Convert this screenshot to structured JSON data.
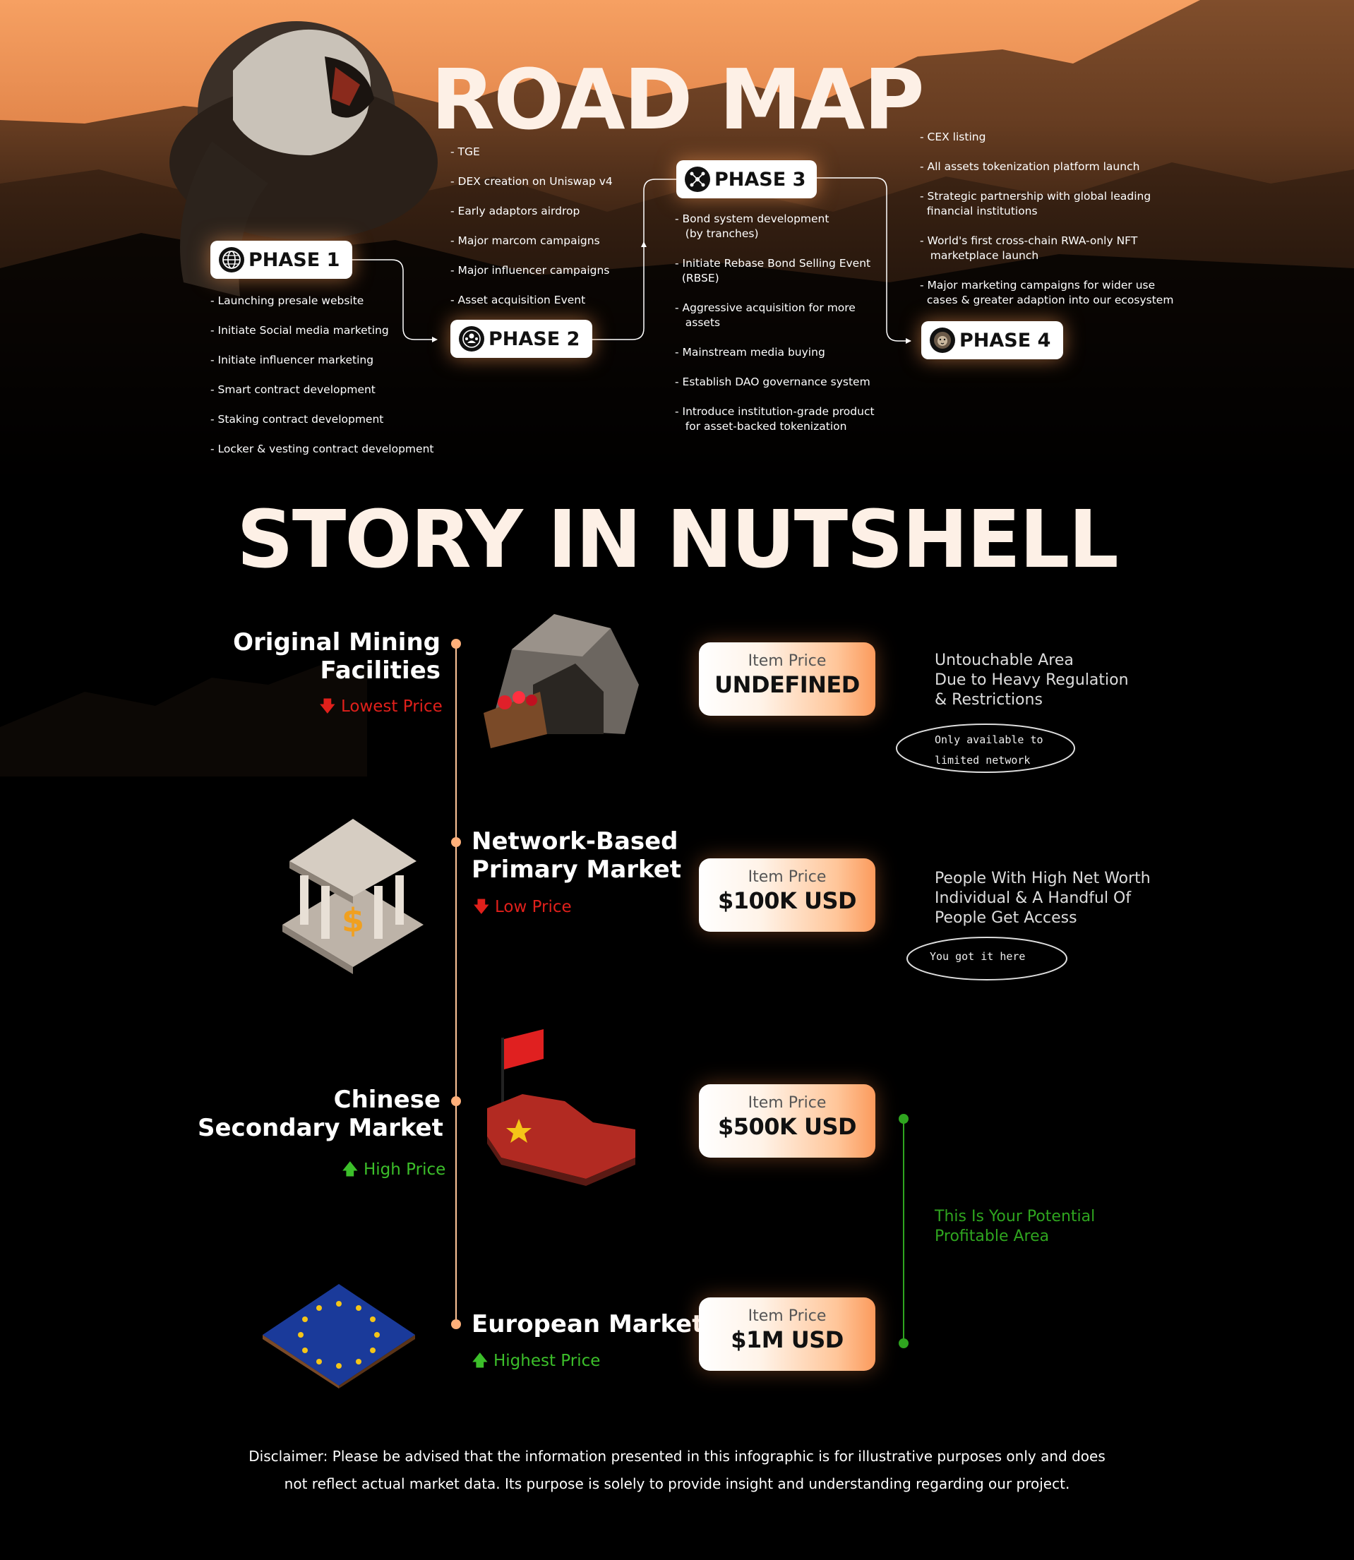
{
  "roadmap": {
    "title": "ROAD MAP",
    "phases": [
      {
        "label": "PHASE 1",
        "icon": "globe-icon",
        "items": [
          "- Launching presale website",
          "- Initiate Social media marketing",
          "- Initiate influencer marketing",
          "- Smart contract development",
          "- Staking contract development",
          "- Locker & vesting contract development"
        ]
      },
      {
        "label": "PHASE 2",
        "icon": "users-icon",
        "items": [
          "- TGE",
          "- DEX creation on Uniswap v4",
          "- Early adaptors airdrop",
          "- Major marcom campaigns",
          "- Major influencer campaigns",
          "- Asset acquisition Event"
        ]
      },
      {
        "label": "PHASE 3",
        "icon": "network-icon",
        "items": [
          "- Bond system development\n   (by tranches)",
          "- Initiate Rebase Bond Selling Event\n  (RBSE)",
          "- Aggressive acquisition for more\n   assets",
          "- Mainstream media buying",
          "- Establish DAO governance system",
          "- Introduce institution-grade product\n   for asset-backed tokenization"
        ]
      },
      {
        "label": "PHASE 4",
        "icon": "lion-icon",
        "items": [
          "- CEX listing",
          "- All assets tokenization platform launch",
          "- Strategic partnership with global leading\n  financial institutions",
          "- World's first cross-chain RWA-only NFT\n   marketplace launch",
          "- Major marketing campaigns for wider use\n  cases & greater adaption into our ecosystem"
        ]
      }
    ]
  },
  "story": {
    "title": "STORY IN NUTSHELL",
    "stages": [
      {
        "title": "Original Mining\nFacilities",
        "price_level": "Lowest Price",
        "direction": "down",
        "card_label": "Item Price",
        "card_value": "UNDEFINED",
        "description": "Untouchable Area\nDue to Heavy Regulation\n& Restrictions",
        "note": "Only available to\nlimited network",
        "illustration": "mine-cart-icon"
      },
      {
        "title": "Network-Based\nPrimary Market",
        "price_level": "Low Price",
        "direction": "down",
        "card_label": "Item Price",
        "card_value": "$100K USD",
        "description": "People With High Net Worth\nIndividual & A Handful Of\nPeople Get Access",
        "note": "You got it here",
        "illustration": "bank-icon"
      },
      {
        "title": "Chinese\nSecondary Market",
        "price_level": "High Price",
        "direction": "up",
        "card_label": "Item Price",
        "card_value": "$500K USD",
        "illustration": "china-map-icon"
      },
      {
        "title": "European Market",
        "price_level": "Highest Price",
        "direction": "up",
        "card_label": "Item Price",
        "card_value": "$1M USD",
        "illustration": "eu-flag-icon"
      }
    ],
    "profit_text": "This Is Your Potential\nProfitable Area"
  },
  "disclaimer": {
    "line1": "Disclaimer: Please be advised that the information presented in this infographic is for illustrative purposes only and does",
    "line2": "not reflect actual market data. Its purpose is solely to provide insight and understanding regarding our project."
  },
  "colors": {
    "accent": "#fb9a5c",
    "down": "#e0201b",
    "up": "#3cbf2a",
    "profit": "#2fa51f"
  }
}
